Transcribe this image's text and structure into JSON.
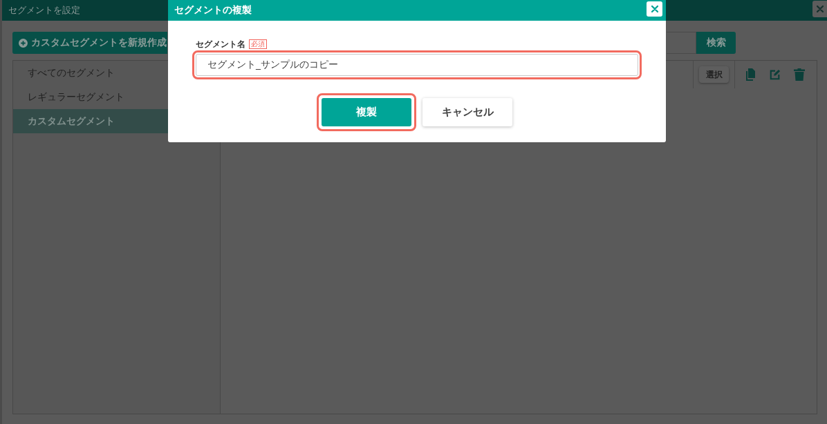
{
  "settings_dialog": {
    "title": "セグメントを設定",
    "create_button": "カスタムセグメントを新規作成",
    "search_button": "検索",
    "segment_list": [
      {
        "label": "すべてのセグメント",
        "selected": false
      },
      {
        "label": "レギュラーセグメント",
        "selected": false
      },
      {
        "label": "カスタムセグメント",
        "selected": true
      }
    ],
    "select_button": "選択"
  },
  "copy_dialog": {
    "title": "セグメントの複製",
    "field": {
      "label": "セグメント名",
      "required_badge": "必須",
      "value": "セグメント_サンプルのコピー",
      "highlighted": true
    },
    "buttons": [
      {
        "label": "複製",
        "kind": "primary",
        "highlighted": true
      },
      {
        "label": "キャンセル",
        "kind": "secondary",
        "highlighted": false
      }
    ]
  }
}
